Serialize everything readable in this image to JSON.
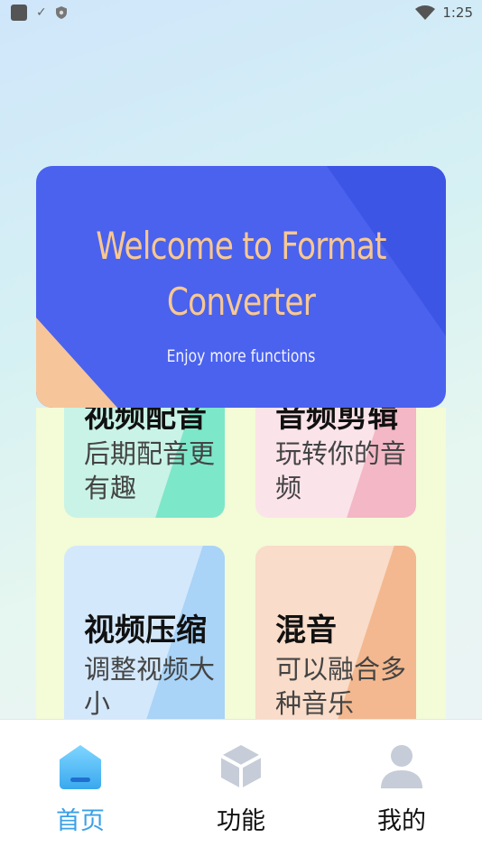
{
  "status_bar": {
    "time": "1:25",
    "icons": [
      "app-square-icon",
      "check-icon",
      "shield-icon",
      "wifi-icon"
    ]
  },
  "banner": {
    "title": "Welcome to Format Converter",
    "subtitle": "Enjoy more functions"
  },
  "cards": [
    {
      "title": "视频配音",
      "desc": "后期配音更有趣"
    },
    {
      "title": "音频剪辑",
      "desc": "玩转你的音频"
    },
    {
      "title": "视频压缩",
      "desc": "调整视频大小"
    },
    {
      "title": "混音",
      "desc": "可以融合多种音乐"
    }
  ],
  "tabs": [
    {
      "label": "首页",
      "icon": "home-icon",
      "active": true
    },
    {
      "label": "功能",
      "icon": "cube-icon",
      "active": false
    },
    {
      "label": "我的",
      "icon": "user-icon",
      "active": false
    }
  ],
  "colors": {
    "banner_bg": "#4a62ee",
    "banner_title": "#f8c892",
    "active_tab": "#3aa0e8"
  }
}
